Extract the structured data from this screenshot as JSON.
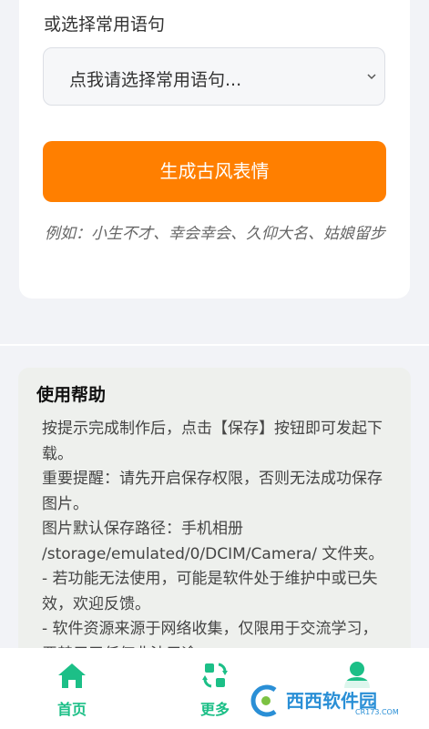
{
  "top_card": {
    "select_caption": "或选择常用语句",
    "select_value": "点我请选择常用语句...",
    "generate_button": "生成古风表情",
    "example_text": "例如：小生不才、幸会幸会、久仰大名、姑娘留步"
  },
  "help": {
    "title": "使用帮助",
    "lines": [
      "按提示完成制作后，点击【保存】按钮即可发起下载。",
      "重要提醒：请先开启保存权限，否则无法成功保存图片。",
      "图片默认保存路径：手机相册 /storage/emulated/0/DCIM/Camera/ 文件夹。",
      "- 若功能无法使用，可能是软件处于维护中或已失效，欢迎反馈。",
      "- 软件资源来源于网络收集，仅限用于交流学习，严禁用于任何非法用途。"
    ]
  },
  "nav": {
    "items": [
      {
        "label": "首页",
        "icon": "home-icon"
      },
      {
        "label": "更多",
        "icon": "more-icon"
      },
      {
        "label": "",
        "icon": "user-icon"
      }
    ],
    "accent": "#1cbf87"
  },
  "watermark": {
    "text": "西西软件园",
    "sub": "CR173.COM"
  },
  "colors": {
    "primary_button": "#ff7f00",
    "background": "#f2f3f7",
    "help_card": "#eef0ed"
  }
}
